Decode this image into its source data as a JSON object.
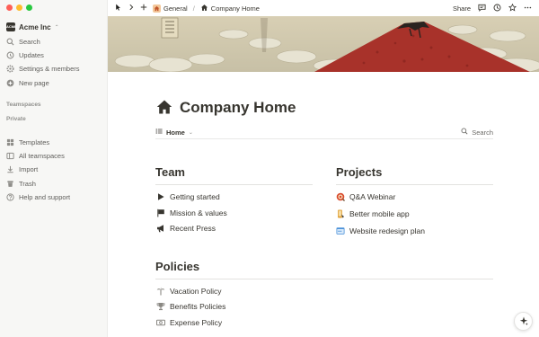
{
  "sidebar": {
    "workspace_logo": "ACME",
    "workspace_name": "Acme Inc",
    "top_items": [
      {
        "label": "Search",
        "icon": "search-icon"
      },
      {
        "label": "Updates",
        "icon": "clock-icon"
      },
      {
        "label": "Settings & members",
        "icon": "gear-icon"
      },
      {
        "label": "New page",
        "icon": "plus-circle-icon"
      }
    ],
    "section_teamspaces": "Teamspaces",
    "section_private": "Private",
    "bottom_items": [
      {
        "label": "Templates",
        "icon": "templates-icon"
      },
      {
        "label": "All teamspaces",
        "icon": "teamspaces-icon"
      },
      {
        "label": "Import",
        "icon": "download-icon"
      },
      {
        "label": "Trash",
        "icon": "trash-icon"
      },
      {
        "label": "Help and support",
        "icon": "question-icon"
      }
    ]
  },
  "topbar": {
    "breadcrumb_parent": "General",
    "breadcrumb_separator": "/",
    "breadcrumb_current": "Company Home",
    "share_label": "Share"
  },
  "page": {
    "title": "Company Home",
    "view_name": "Home",
    "search_label": "Search",
    "team": {
      "heading": "Team",
      "items": [
        {
          "label": "Getting started",
          "icon": "play-icon"
        },
        {
          "label": "Mission & values",
          "icon": "flag-icon"
        },
        {
          "label": "Recent Press",
          "icon": "megaphone-icon"
        }
      ]
    },
    "projects": {
      "heading": "Projects",
      "items": [
        {
          "label": "Q&A Webinar",
          "icon": "target-icon"
        },
        {
          "label": "Better mobile app",
          "icon": "phone-icon"
        },
        {
          "label": "Website redesign plan",
          "icon": "browser-icon"
        }
      ]
    },
    "policies": {
      "heading": "Policies",
      "items": [
        {
          "label": "Vacation Policy",
          "icon": "palm-tree-icon"
        },
        {
          "label": "Benefits Policies",
          "icon": "trophy-icon"
        },
        {
          "label": "Expense Policy",
          "icon": "money-icon"
        }
      ]
    }
  },
  "colors": {
    "sidebar_bg": "#f7f7f5",
    "text": "#37352f",
    "muted": "#91918e",
    "cover_red": "#a8322a"
  }
}
